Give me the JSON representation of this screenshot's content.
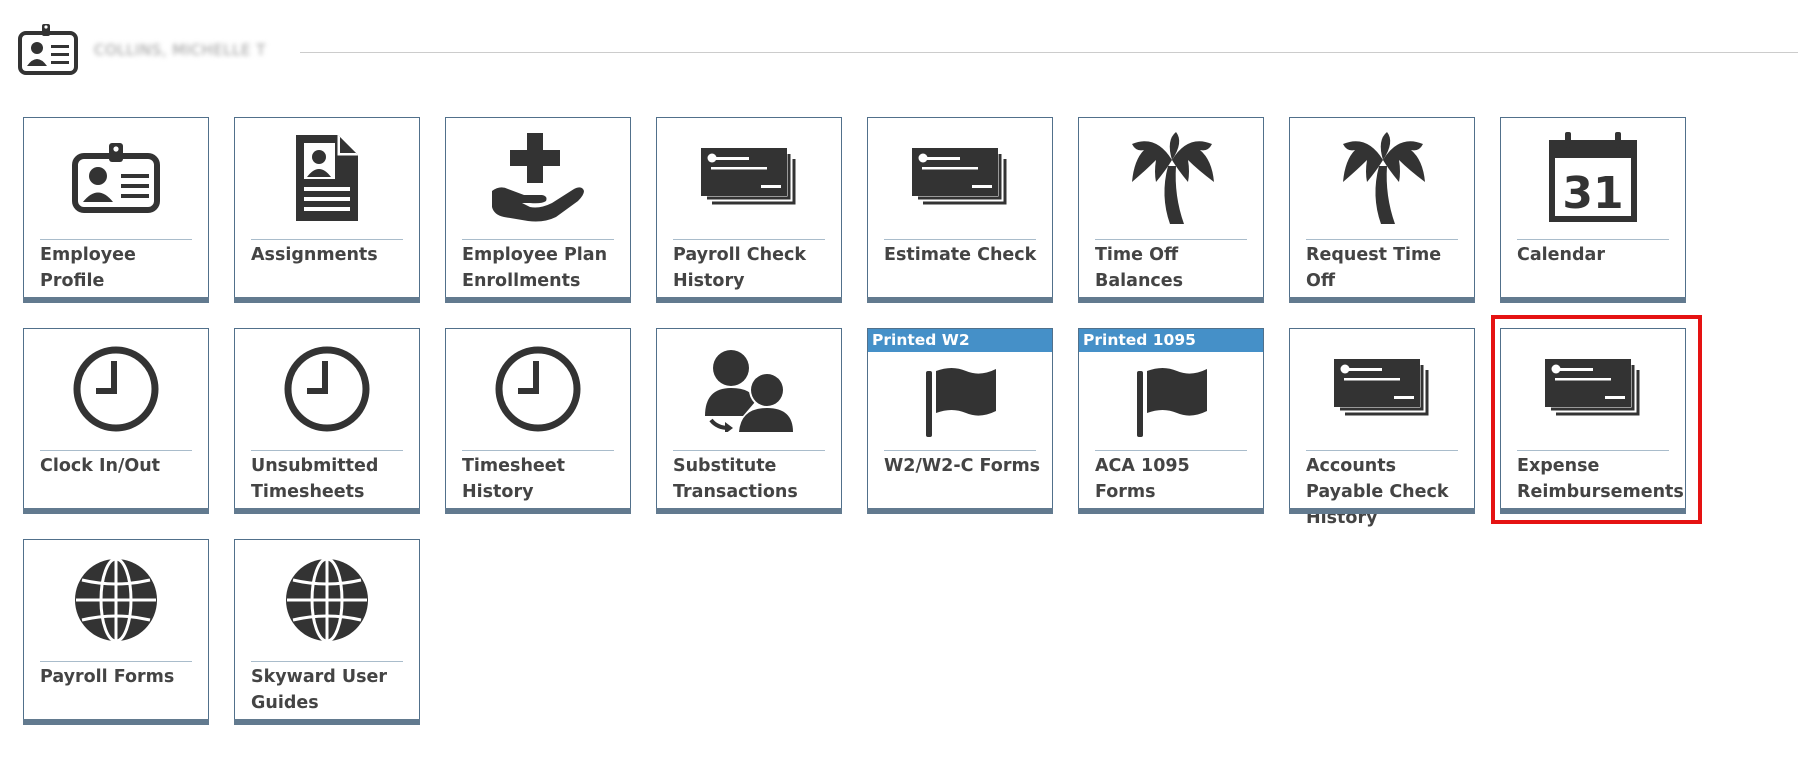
{
  "header": {
    "user_name": "COLLINS, MICHELLE T",
    "icon": "id-badge-icon"
  },
  "tiles": [
    {
      "label": "Employee Profile",
      "icon": "id-badge-icon"
    },
    {
      "label": "Assignments",
      "icon": "document-person-icon"
    },
    {
      "label": "Employee Plan Enrollments",
      "icon": "hand-plus-icon"
    },
    {
      "label": "Payroll Check History",
      "icon": "check-icon"
    },
    {
      "label": "Estimate Check",
      "icon": "check-icon"
    },
    {
      "label": "Time Off Balances",
      "icon": "palm-tree-icon"
    },
    {
      "label": "Request Time Off",
      "icon": "palm-tree-icon"
    },
    {
      "label": "Calendar",
      "icon": "calendar-icon",
      "calendar_day": "31"
    },
    {
      "label": "Clock In/Out",
      "icon": "clock-icon"
    },
    {
      "label": "Unsubmitted Timesheets",
      "icon": "clock-icon"
    },
    {
      "label": "Timesheet History",
      "icon": "clock-icon"
    },
    {
      "label": "Substitute Transactions",
      "icon": "substitute-people-icon"
    },
    {
      "label": "W2/W2-C Forms",
      "icon": "flag-icon",
      "banner": "Printed W2"
    },
    {
      "label": "ACA 1095 Forms",
      "icon": "flag-icon",
      "banner": "Printed 1095"
    },
    {
      "label": "Accounts Payable Check History",
      "icon": "check-icon"
    },
    {
      "label": "Expense Reimbursements",
      "icon": "check-icon"
    },
    {
      "label": "Payroll Forms",
      "icon": "globe-icon"
    },
    {
      "label": "Skyward User Guides",
      "icon": "globe-icon"
    }
  ],
  "colors": {
    "icon": "#333333",
    "banner": "#4590c8",
    "tile_border": "#51708b",
    "tile_bottom_bar": "#627a8f",
    "highlight": "#e51212"
  }
}
